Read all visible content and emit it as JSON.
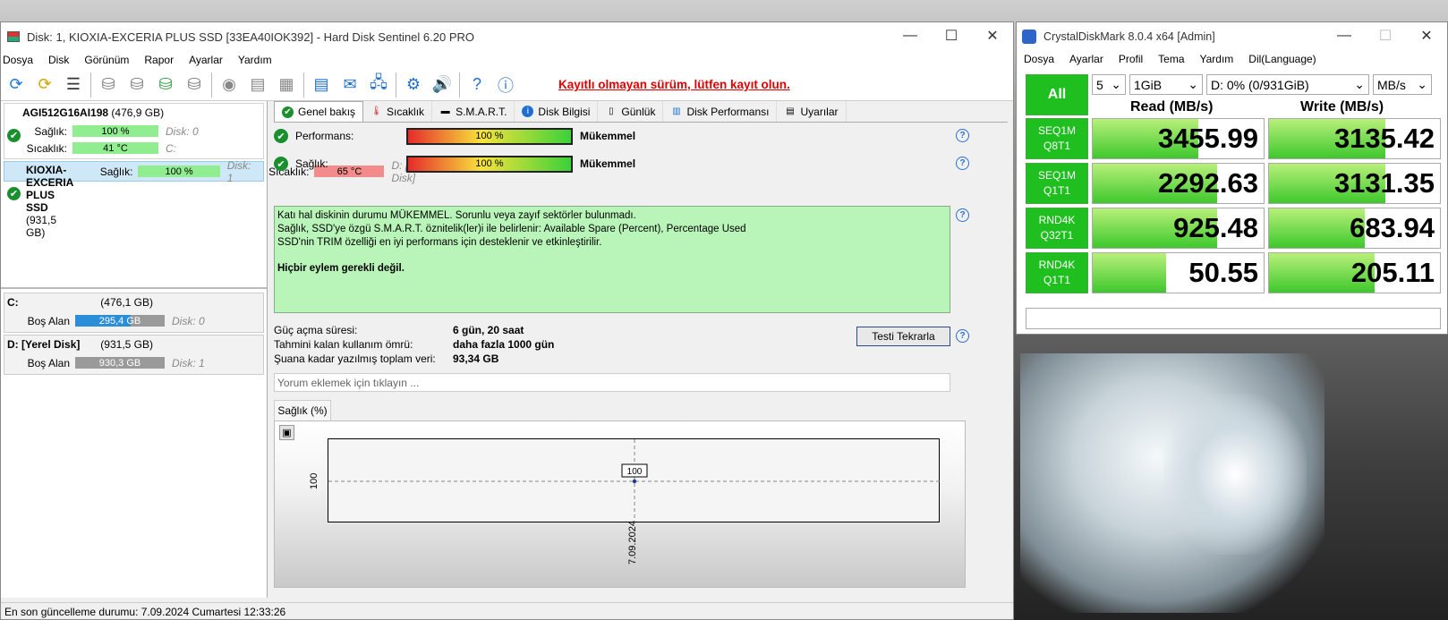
{
  "hds": {
    "title": "Disk: 1, KIOXIA-EXCERIA PLUS SSD [33EA40IOK392]  -  Hard Disk Sentinel 6.20 PRO",
    "menu": [
      "Dosya",
      "Disk",
      "Görünüm",
      "Rapor",
      "Ayarlar",
      "Yardım"
    ],
    "register_msg": "Kayıtlı olmayan sürüm, lütfen kayıt olun.",
    "disks": [
      {
        "name": "AGI512G16AI198",
        "size": "(476,9 GB)",
        "health_label": "Sağlık:",
        "health": "100 %",
        "health_pct": 100,
        "health_color": "#90ee90",
        "temp_label": "Sıcaklık:",
        "temp": "41 °C",
        "temp_color": "#90ee90",
        "disk_no": "Disk: 0",
        "drive": "C:"
      },
      {
        "name": "KIOXIA-EXCERIA PLUS SSD",
        "size": "(931,5 GB)",
        "health_label": "Sağlık:",
        "health": "100 %",
        "health_pct": 100,
        "health_color": "#90ee90",
        "temp_label": "Sıcaklık:",
        "temp": "65 °C",
        "temp_color": "#f28b8b",
        "disk_no": "Disk: 1",
        "drive": "D: [Yerel Disk]"
      }
    ],
    "volumes": [
      {
        "name": "C:",
        "size": "(476,1 GB)",
        "free_label": "Boş Alan",
        "free": "295,4 GB",
        "free_pct": 0.62,
        "disk": "Disk: 0"
      },
      {
        "name": "D: [Yerel Disk]",
        "size": "(931,5 GB)",
        "free_label": "Boş Alan",
        "free": "930,3 GB",
        "free_pct": 0.0,
        "disk": "Disk: 1"
      }
    ],
    "tabs": [
      "Genel bakış",
      "Sıcaklık",
      "S.M.A.R.T.",
      "Disk Bilgisi",
      "Günlük",
      "Disk Performansı",
      "Uyarılar"
    ],
    "performance": {
      "label": "Performans:",
      "value": "100 %",
      "rating": "Mükemmel"
    },
    "health": {
      "label": "Sağlık:",
      "value": "100 %",
      "rating": "Mükemmel"
    },
    "message_lines": [
      "Katı hal diskinin durumu MÜKEMMEL. Sorunlu veya zayıf sektörler bulunmadı.",
      "Sağlık, SSD'ye özgü S.M.A.R.T. öznitelik(ler)i ile belirlenir:  Available Spare (Percent), Percentage Used",
      "SSD'nin TRIM özelliği en iyi performans için desteklenir ve etkinleştirilir."
    ],
    "message_bold": "Hiçbir eylem gerekli değil.",
    "info": [
      {
        "k": "Güç açma süresi:",
        "v": "6 gün, 20 saat"
      },
      {
        "k": "Tahmini kalan kullanım ömrü:",
        "v": "daha fazla 1000 gün"
      },
      {
        "k": "Şuana kadar yazılmış toplam veri:",
        "v": "93,34 GB"
      }
    ],
    "retest_button": "Testi Tekrarla",
    "comment_placeholder": "Yorum eklemek için tıklayın ...",
    "chart_tab": "Sağlık (%)",
    "status": "En son güncelleme durumu: 7.09.2024 Cumartesi 12:33:26"
  },
  "chart_data": {
    "type": "line",
    "title": "",
    "x": [
      "7.09.2024"
    ],
    "series": [
      {
        "values": [
          100
        ]
      }
    ],
    "ylabel": "",
    "ytick_labels": [
      "100"
    ],
    "data_labels": [
      "100"
    ],
    "grid": true
  },
  "cdm": {
    "title": "CrystalDiskMark 8.0.4 x64 [Admin]",
    "menu": [
      "Dosya",
      "Ayarlar",
      "Profil",
      "Tema",
      "Yardım",
      "Dil(Language)"
    ],
    "all_button": "All",
    "count": "5",
    "size": "1GiB",
    "drive": "D: 0% (0/931GiB)",
    "unit": "MB/s",
    "read_header": "Read (MB/s)",
    "write_header": "Write (MB/s)",
    "rows": [
      {
        "t1": "SEQ1M",
        "t2": "Q8T1",
        "read": "3455.99",
        "read_fill": 0.62,
        "write": "3135.42",
        "write_fill": 0.68
      },
      {
        "t1": "SEQ1M",
        "t2": "Q1T1",
        "read": "2292.63",
        "read_fill": 0.73,
        "write": "3131.35",
        "write_fill": 0.68
      },
      {
        "t1": "RND4K",
        "t2": "Q32T1",
        "read": "925.48",
        "read_fill": 0.73,
        "write": "683.94",
        "write_fill": 0.56
      },
      {
        "t1": "RND4K",
        "t2": "Q1T1",
        "read": "50.55",
        "read_fill": 0.43,
        "write": "205.11",
        "write_fill": 0.62
      }
    ]
  }
}
